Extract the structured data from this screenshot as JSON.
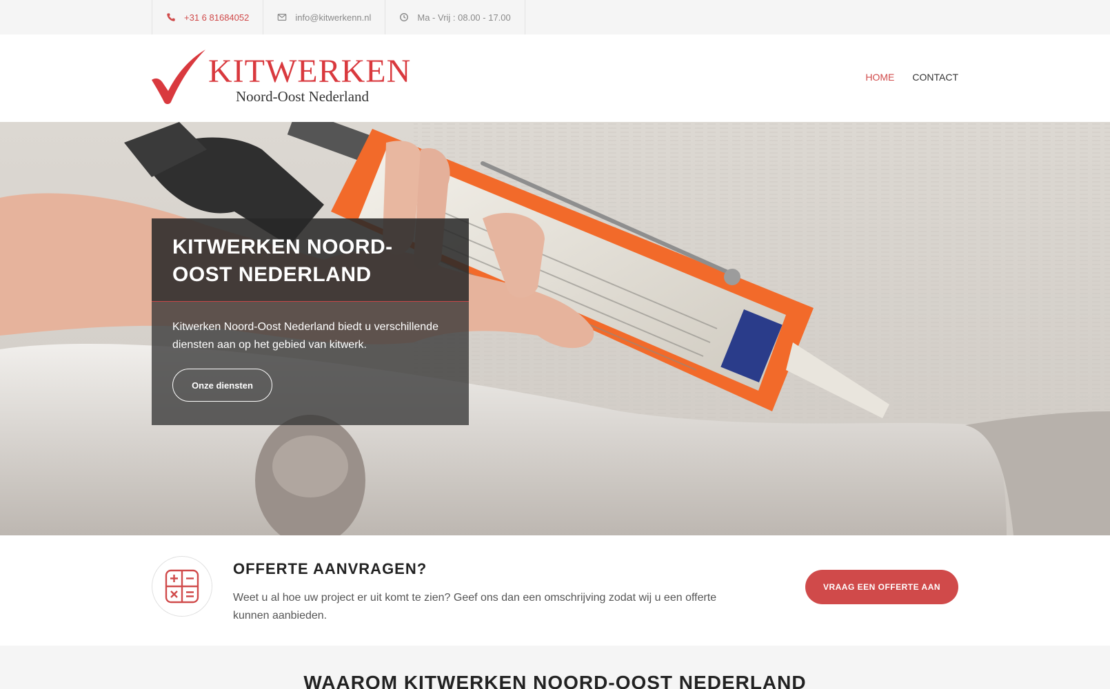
{
  "topbar": {
    "phone": "+31 6 81684052",
    "email": "info@kitwerkenn.nl",
    "hours": "Ma - Vrij : 08.00 - 17.00",
    "icons": [
      "phone-icon",
      "envelope-icon",
      "clock-icon"
    ]
  },
  "logo": {
    "title": "KITWERKEN",
    "subtitle": "Noord-Oost Nederland"
  },
  "nav": {
    "items": [
      {
        "label": "HOME",
        "active": true
      },
      {
        "label": "CONTACT",
        "active": false
      }
    ]
  },
  "hero": {
    "title": "KITWERKEN NOORD-OOST NEDERLAND",
    "text": "Kitwerken Noord-Oost Nederland biedt u verschillende diensten aan op het gebied van kitwerk.",
    "button": "Onze diensten"
  },
  "offerte": {
    "title": "OFFERTE AANVRAGEN?",
    "text": "Weet u al hoe uw project er uit komt te zien? Geef ons dan een omschrijving zodat wij u een offerte kunnen aanbieden.",
    "button": "VRAAG EEN OFFERTE AAN",
    "icon": "calculator-icon"
  },
  "waarom": {
    "title": "WAAROM KITWERKEN NOORD-OOST NEDERLAND"
  },
  "colors": {
    "accent": "#d04a4a",
    "logo_red": "#d9393e",
    "topbar_bg": "#f5f5f5",
    "caulk_gun_orange": "#f26a2a"
  }
}
